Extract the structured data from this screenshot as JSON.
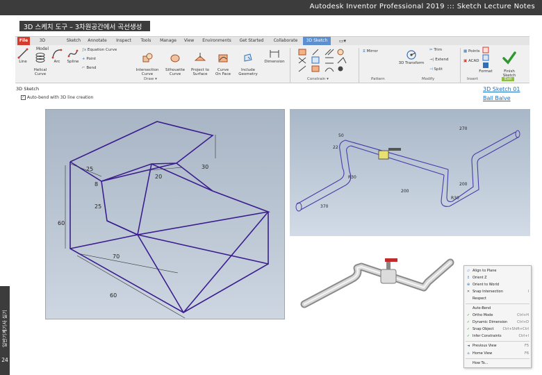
{
  "header": {
    "title": "Autodesk Inventor Professional 2019 ::: Sketch Lecture Notes"
  },
  "slide": {
    "label": "3D 스케치 도구 – 3차원공간에서 곡선생성",
    "page_number": "24",
    "side_text": "일반기계기사 실기"
  },
  "ribbon": {
    "tabs": [
      "File",
      "3D Model",
      "Sketch",
      "Annotate",
      "Inspect",
      "Tools",
      "Manage",
      "View",
      "Environments",
      "Get Started",
      "Collaborate",
      "3D Sketch"
    ],
    "draw_tools": {
      "line": "Line",
      "helical": "Helical\nCurve",
      "arc": "Arc",
      "spline": "Spline",
      "equation_curve": "Equation Curve",
      "point": "Point",
      "bend": "Bend",
      "intersection": "Intersection\nCurve",
      "silhouette": "Silhouette\nCurve",
      "project_surface": "Project to\nSurface",
      "curve_on_face": "Curve\nOn Face",
      "include_geometry": "Include\nGeometry",
      "dimension": "Dimension"
    },
    "modify_tools": {
      "mirror": "Mirror",
      "transform": "3D Transform",
      "trim": "Trim",
      "extend": "Extend",
      "split": "Split"
    },
    "insert_tools": {
      "points": "Points",
      "acad": "ACAD"
    },
    "format_label": "Format",
    "finish_label": "Finish\nSketch",
    "exit_label": "Exit",
    "groups": {
      "draw": "Draw ▾",
      "constrain": "Constrain ▾",
      "pattern": "Pattern",
      "modify": "Modify",
      "insert": "Insert",
      "exit": "Exit"
    }
  },
  "browser": {
    "title": "3D Sketch",
    "checkbox_label": "Auto-bend with 3D line creation"
  },
  "links": {
    "file1": "3D Sketch 01",
    "file2": "Ball Balve"
  },
  "viewport_left": {
    "dims": [
      "25",
      "20",
      "30",
      "8",
      "25",
      "60",
      "70",
      "60"
    ]
  },
  "viewport_right": {
    "dims": [
      "270",
      "50",
      "22",
      "R30",
      "200",
      "200",
      "370",
      "R30"
    ]
  },
  "context_menu": {
    "items": [
      {
        "label": "Align to Plane",
        "shortcut": "",
        "icon": "align-plane"
      },
      {
        "label": "Orient Z",
        "shortcut": "",
        "icon": "orient-z"
      },
      {
        "label": "Orient to World",
        "shortcut": "",
        "icon": "orient-world"
      },
      {
        "label": "Snap Intersection",
        "shortcut": "I",
        "icon": "snap-intersection"
      },
      {
        "label": "Respect",
        "shortcut": "",
        "icon": "none"
      },
      {
        "label": "Auto-Bend",
        "shortcut": "",
        "icon": "none"
      },
      {
        "label": "Ortho Mode",
        "shortcut": "Ctrl+H",
        "icon": "check"
      },
      {
        "label": "Dynamic Dimension",
        "shortcut": "Ctrl+D",
        "icon": "check"
      },
      {
        "label": "Snap Object",
        "shortcut": "Ctrl+Shift+Ctrl",
        "icon": "check"
      },
      {
        "label": "Infer Constraints",
        "shortcut": "Ctrl+I",
        "icon": "check"
      },
      {
        "label": "Previous View",
        "shortcut": "F5",
        "icon": "prev-view"
      },
      {
        "label": "Home View",
        "shortcut": "F6",
        "icon": "home-view"
      },
      {
        "label": "How To...",
        "shortcut": "",
        "icon": "none"
      }
    ]
  }
}
